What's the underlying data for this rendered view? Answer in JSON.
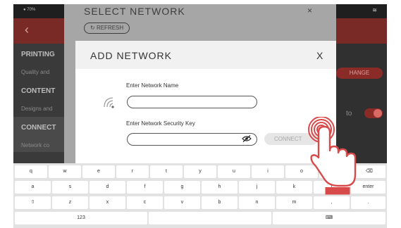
{
  "status": {
    "battery": "70%"
  },
  "sidebar": {
    "sections": [
      {
        "title": "PRINTING",
        "subtitle": "Quality and"
      },
      {
        "title": "CONTENT",
        "subtitle": "Designs and"
      },
      {
        "title": "CONNECT",
        "subtitle": "Network co"
      }
    ]
  },
  "settings_panel": {
    "change_label": "HANGE",
    "toggle_label": "to"
  },
  "select_network": {
    "title": "SELECT NETWORK",
    "refresh_label": "REFRESH",
    "close_glyph": "×"
  },
  "add_network": {
    "title": "ADD NETWORK",
    "close_glyph": "X",
    "name_label": "Enter Network Name",
    "name_value": "",
    "key_label": "Enter Network Security Key",
    "key_value": "",
    "connect_label": "CONNECT"
  },
  "keyboard": {
    "row1": [
      "q",
      "w",
      "e",
      "r",
      "t",
      "y",
      "u",
      "i",
      "o",
      "p",
      "⌫"
    ],
    "row2": [
      "a",
      "s",
      "d",
      "f",
      "g",
      "h",
      "j",
      "k",
      "l",
      "enter"
    ],
    "row3": [
      "⇧",
      "z",
      "x",
      "c",
      "v",
      "b",
      "n",
      "m",
      ",",
      "."
    ],
    "row4": {
      "numbers": "123",
      "space": "",
      "emoji": "☺",
      "keyboard": "⌨"
    }
  },
  "icons": {
    "back": "chevron-left-icon",
    "wifi_status": "wifi-icon",
    "wifi_signal": "wifi-signal-icon",
    "eye": "eye-off-icon",
    "refresh": "refresh-icon",
    "hand": "tap-hand-icon"
  },
  "colors": {
    "accent": "#8a2b28",
    "appbar": "#7a2a26",
    "hand": "#d84a4a",
    "dim_sheet": "#a6a6a6"
  }
}
